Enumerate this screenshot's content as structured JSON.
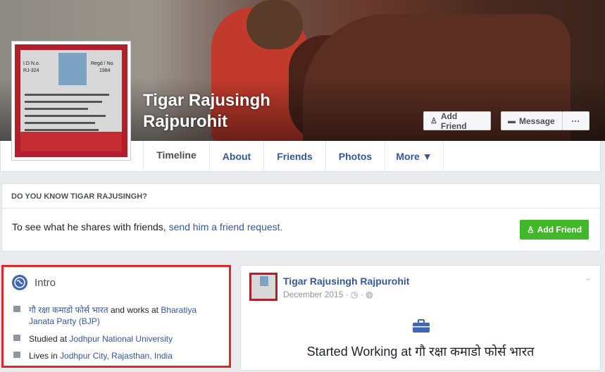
{
  "profile": {
    "name_line1": "Tigar Rajusingh",
    "name_line2": "Rajpurohit",
    "id_card": {
      "id_label": "I.D N.o.",
      "id_value": "RJ-324",
      "regd_label": "Regd / No.",
      "regd_value": "1984"
    }
  },
  "header_buttons": {
    "add_friend": "Add Friend",
    "message": "Message",
    "more": "···"
  },
  "tabs": [
    {
      "label": "Timeline"
    },
    {
      "label": "About"
    },
    {
      "label": "Friends"
    },
    {
      "label": "Photos"
    },
    {
      "label": "More ▼"
    }
  ],
  "know_box": {
    "title": "DO YOU KNOW TIGAR RAJUSINGH?",
    "text_prefix": "To see what he shares with friends, ",
    "link": "send him a friend request.",
    "button": "Add Friend"
  },
  "intro": {
    "title": "Intro",
    "work_link": "गौ रक्षा कमाडो फोर्स भारत",
    "work_mid": " and works at ",
    "work_org1": "Bharatiya",
    "work_org2": "Janata Party (BJP)",
    "studied_prefix": "Studied at ",
    "studied_link": "Jodhpur National University",
    "lives_prefix": "Lives in ",
    "lives_link": "Jodhpur City, Rajasthan, India"
  },
  "post": {
    "author": "Tigar Rajusingh Rajpurohit",
    "date": "December 2015 · ◷ · ◍",
    "event_text": "Started Working at गौ रक्षा कमाडो फोर्स भारत"
  },
  "colors": {
    "link": "#365899",
    "green": "#42b72a",
    "highlight": "#e0282c"
  }
}
